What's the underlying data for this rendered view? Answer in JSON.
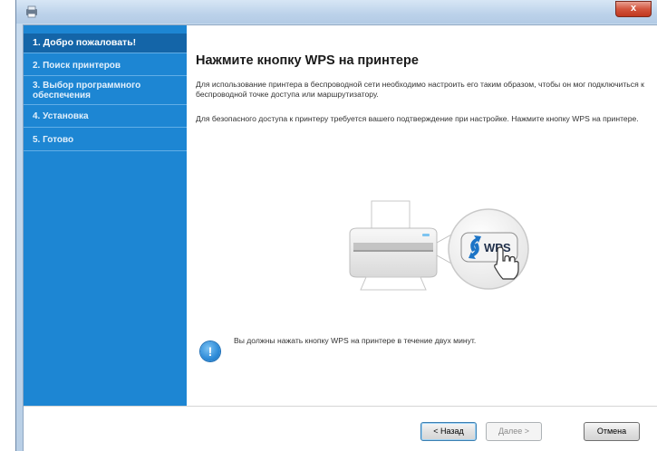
{
  "window": {
    "title": "",
    "close_symbol": "x"
  },
  "sidebar": {
    "steps": [
      {
        "label": "1. Добро пожаловать!",
        "active": true
      },
      {
        "label": "2. Поиск принтеров",
        "active": false
      },
      {
        "label": "3. Выбор программного обеспечения",
        "active": false
      },
      {
        "label": "4. Установка",
        "active": false
      },
      {
        "label": "5. Готово",
        "active": false
      }
    ]
  },
  "main": {
    "title": "Нажмите кнопку WPS на принтере",
    "paragraph_1": "Для использование принтера в беспроводной сети необходимо настроить его таким образом, чтобы он мог подключиться к беспроводной точке доступа или маршрутизатору.",
    "paragraph_2": "Для безопасного доступа к принтеру требуется вашего подтверждение при настройке. Нажмите кнопку WPS на принтере.",
    "wps_label": "WPS",
    "notice": "Вы должны нажать кнопку WPS на принтере в течение двух минут.",
    "notice_symbol": "!"
  },
  "footer": {
    "back_label": "< Назад",
    "next_label": "Далее >",
    "cancel_label": "Отмена"
  },
  "icons": {
    "app": "app-icon",
    "notice": "info-exclamation-icon",
    "printer": "printer-icon",
    "wps": "wps-button-icon",
    "hand": "hand-pointer-icon"
  },
  "colors": {
    "sidebar": "#1d86d3",
    "sidebar_active": "#1465a8",
    "close_button": "#c1381f",
    "wps_blue": "#1c74c6"
  }
}
